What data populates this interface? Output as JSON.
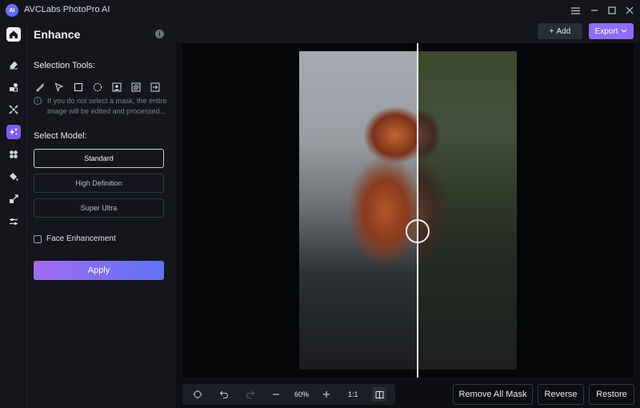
{
  "app": {
    "title": "AVCLabs PhotoPro AI",
    "logo_text": "AI"
  },
  "window": {
    "menu_icon": "hamburger-menu-icon",
    "minimize_icon": "minimize-icon",
    "maximize_icon": "maximize-icon",
    "close_icon": "close-icon"
  },
  "sidebar": {
    "items": [
      {
        "name": "home",
        "icon": "home-icon"
      },
      {
        "name": "eraser",
        "icon": "eraser-icon"
      },
      {
        "name": "object",
        "icon": "shapes-icon"
      },
      {
        "name": "expand",
        "icon": "expand-icon"
      },
      {
        "name": "enhance",
        "icon": "sparkle-icon",
        "active": true
      },
      {
        "name": "fan",
        "icon": "fan-icon"
      },
      {
        "name": "fill",
        "icon": "paint-bucket-icon"
      },
      {
        "name": "resize",
        "icon": "resize-icon"
      },
      {
        "name": "adjust",
        "icon": "sliders-icon"
      }
    ]
  },
  "panel": {
    "title": "Enhance",
    "selection_tools_label": "Selection Tools:",
    "tools": [
      "brush-icon",
      "lasso-icon",
      "rectangle-select-icon",
      "ellipse-select-icon",
      "portrait-select-icon",
      "pattern-select-icon",
      "import-mask-icon"
    ],
    "note": "If you do not select a mask, the entire image will be edited and processed...",
    "select_model_label": "Select Model:",
    "models": [
      "Standard",
      "High Definition",
      "Super Ultra"
    ],
    "selected_model": "Standard",
    "face_enhancement_label": "Face Enhancement",
    "face_enhancement_checked": false,
    "apply_label": "Apply"
  },
  "toolbar": {
    "add_label": "Add",
    "export_label": "Export"
  },
  "bottombar": {
    "zoom": "60%",
    "one_to_one": "1:1",
    "remove_all_mask_label": "Remove All Mask",
    "reverse_label": "Reverse",
    "restore_label": "Restore"
  },
  "colors": {
    "accent": "#8f6df4",
    "apply_gradient_start": "#a06cf0",
    "apply_gradient_end": "#5f72f4"
  }
}
